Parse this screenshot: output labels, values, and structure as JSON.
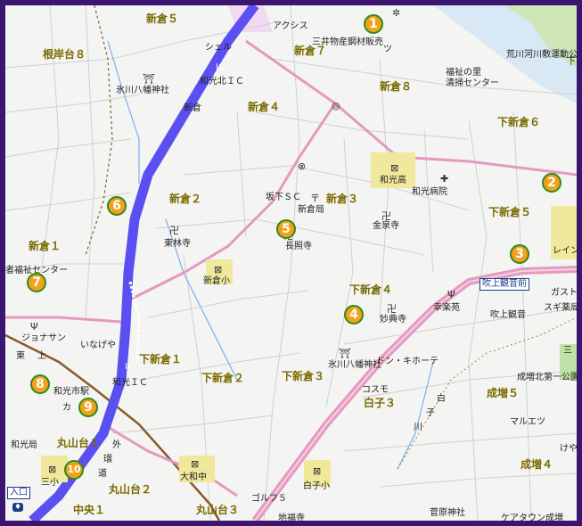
{
  "areas": [
    {
      "text": "新倉５"
    },
    {
      "text": "根岸台８"
    },
    {
      "text": "新倉７"
    },
    {
      "text": "新倉８"
    },
    {
      "text": "新倉４"
    },
    {
      "text": "下新倉６"
    },
    {
      "text": "新倉２"
    },
    {
      "text": "新倉３"
    },
    {
      "text": "下新倉５"
    },
    {
      "text": "新倉１"
    },
    {
      "text": "下新倉４"
    },
    {
      "text": "下新倉１"
    },
    {
      "text": "下新倉２"
    },
    {
      "text": "下新倉３"
    },
    {
      "text": "白子３"
    },
    {
      "text": "成増５"
    },
    {
      "text": "丸山台１"
    },
    {
      "text": "丸山台２"
    },
    {
      "text": "丸山台３"
    },
    {
      "text": "成増４"
    },
    {
      "text": "中央１"
    }
  ],
  "places": [
    {
      "text": "アクシス"
    },
    {
      "text": "三井物産鋼材販売"
    },
    {
      "text": "シェル"
    },
    {
      "text": "荒川河川敷運動公"
    },
    {
      "text": "福祉の里"
    },
    {
      "text": "清掃センター"
    },
    {
      "text": "氷川八幡神社"
    },
    {
      "text": "和光北ＩＣ"
    },
    {
      "text": "新倉"
    },
    {
      "text": "坂下ＳＣ"
    },
    {
      "text": "新倉局"
    },
    {
      "text": "和光高"
    },
    {
      "text": "和光病院"
    },
    {
      "text": "金泉寺"
    },
    {
      "text": "東林寺"
    },
    {
      "text": "長照寺"
    },
    {
      "text": "者福祉センター"
    },
    {
      "text": "新倉小"
    },
    {
      "text": "レイン"
    },
    {
      "text": "吹上観音前"
    },
    {
      "text": "ガスト"
    },
    {
      "text": "スギ薬局"
    },
    {
      "text": "幸楽苑"
    },
    {
      "text": "吹上観音"
    },
    {
      "text": "妙典寺"
    },
    {
      "text": "いなげや"
    },
    {
      "text": "氷川八幡神社"
    },
    {
      "text": "ドン・キホーテ"
    },
    {
      "text": "和光市駅"
    },
    {
      "text": "和光ＩＣ"
    },
    {
      "text": "コスモ"
    },
    {
      "text": "成増北第一公園"
    },
    {
      "text": "マルエツ"
    },
    {
      "text": "和光局"
    },
    {
      "text": "大和中"
    },
    {
      "text": "白子小"
    },
    {
      "text": "ゴルフ５"
    },
    {
      "text": "地福寺"
    },
    {
      "text": "菅原神社"
    },
    {
      "text": "ケアタウン成増"
    },
    {
      "text": "外"
    },
    {
      "text": "環"
    },
    {
      "text": "道"
    },
    {
      "text": "三小"
    },
    {
      "text": "IC"
    },
    {
      "text": "IC"
    },
    {
      "text": "白"
    },
    {
      "text": "子"
    },
    {
      "text": "川"
    },
    {
      "text": "けや"
    },
    {
      "text": "下"
    },
    {
      "text": "三"
    },
    {
      "text": "入口"
    },
    {
      "text": "上"
    },
    {
      "text": "東"
    },
    {
      "text": "カ"
    },
    {
      "text": "ジョナサン"
    },
    {
      "text": "ツ"
    }
  ],
  "markers": [
    {
      "num": "1"
    },
    {
      "num": "2"
    },
    {
      "num": "3"
    },
    {
      "num": "4"
    },
    {
      "num": "5"
    },
    {
      "num": "6"
    },
    {
      "num": "7"
    },
    {
      "num": "8"
    },
    {
      "num": "9"
    },
    {
      "num": "10"
    }
  ],
  "colors": {
    "frame": "#3a1670",
    "map_background": "#f4f4f2",
    "expressway": "#5a4ff0",
    "main_road": "#e49ac0",
    "minor_road": "#cfcfcf",
    "railway": "#8a5a2a",
    "river": "#7ab0ee",
    "facility": "#f0e89a",
    "marker_fill": "#f2a21a",
    "marker_ring": "#2f8a20",
    "area_label": "#7a6a00"
  },
  "icons": [
    "school-icon",
    "temple-icon",
    "shrine-icon",
    "post-office-icon",
    "hospital-icon",
    "restaurant-icon",
    "gas-station-icon",
    "bus-stop-icon",
    "route-shield-icon"
  ]
}
